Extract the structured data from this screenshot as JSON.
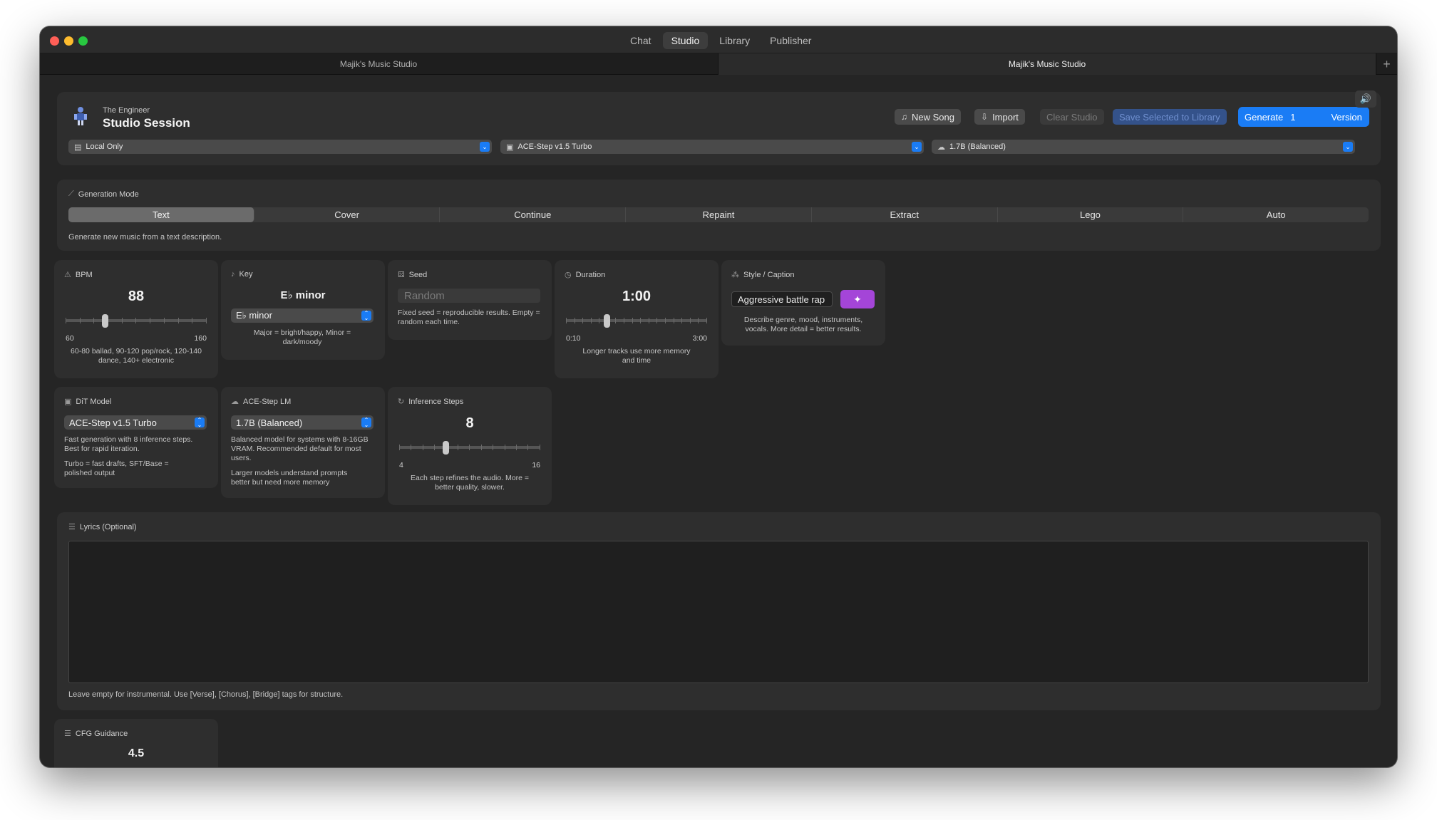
{
  "titlebar": {
    "nav": [
      "Chat",
      "Studio",
      "Library",
      "Publisher"
    ],
    "active_nav": "Studio"
  },
  "tabs": {
    "left": "Majik's Music Studio",
    "right": "Majik's Music Studio",
    "add": "+"
  },
  "header": {
    "subtitle": "The Engineer",
    "title": "Studio Session",
    "new_song": "New Song",
    "import": "Import",
    "clear": "Clear Studio",
    "save": "Save Selected to Library",
    "generate": "Generate",
    "generate_count": "1",
    "generate_suffix": "Version",
    "dropdowns": [
      "Local Only",
      "ACE-Step v1.5 Turbo",
      "1.7B (Balanced)"
    ]
  },
  "mode": {
    "label": "Generation Mode",
    "options": [
      "Text",
      "Cover",
      "Continue",
      "Repaint",
      "Extract",
      "Lego",
      "Auto"
    ],
    "active": "Text",
    "description": "Generate new music from a text description."
  },
  "bpm": {
    "label": "BPM",
    "value": "88",
    "min": "60",
    "max": "160",
    "level": 0.28,
    "note": "60-80 ballad, 90-120 pop/rock, 120-140 dance, 140+ electronic"
  },
  "key": {
    "label": "Key",
    "value": "E♭ minor",
    "select": "E♭ minor",
    "note": "Major = bright/happy, Minor = dark/moody"
  },
  "seed": {
    "label": "Seed",
    "placeholder": "Random",
    "note": "Fixed seed = reproducible results. Empty = random each time."
  },
  "duration": {
    "label": "Duration",
    "value": "1:00",
    "min": "0:10",
    "max": "3:00",
    "level": 0.29,
    "note": "Longer tracks use more memory and time"
  },
  "style": {
    "label": "Style / Caption",
    "value": "Aggressive battle rap",
    "note": "Describe genre, mood, instruments, vocals. More detail = better results."
  },
  "dit": {
    "label": "DiT Model",
    "select": "ACE-Step v1.5 Turbo",
    "note1": "Fast generation with 8 inference steps. Best for rapid iteration.",
    "note2": "Turbo = fast drafts, SFT/Base = polished output"
  },
  "lm": {
    "label": "ACE-Step LM",
    "select": "1.7B (Balanced)",
    "note1": "Balanced model for systems with 8-16GB VRAM. Recommended default for most users.",
    "note2": "Larger models understand prompts better but need more memory"
  },
  "steps": {
    "label": "Inference Steps",
    "value": "8",
    "min": "4",
    "max": "16",
    "level": 0.33,
    "note": "Each step refines the audio. More = better quality, slower."
  },
  "lyrics": {
    "label": "Lyrics (Optional)",
    "value": "",
    "note": "Leave empty for instrumental. Use [Verse], [Chorus], [Bridge] tags for structure."
  },
  "cfg": {
    "label": "CFG Guidance",
    "value": "4.5"
  },
  "colors": {
    "accent": "#1a7cf5",
    "magic": "#a445d8",
    "panel": "#2e2e2e",
    "window": "#252525"
  }
}
